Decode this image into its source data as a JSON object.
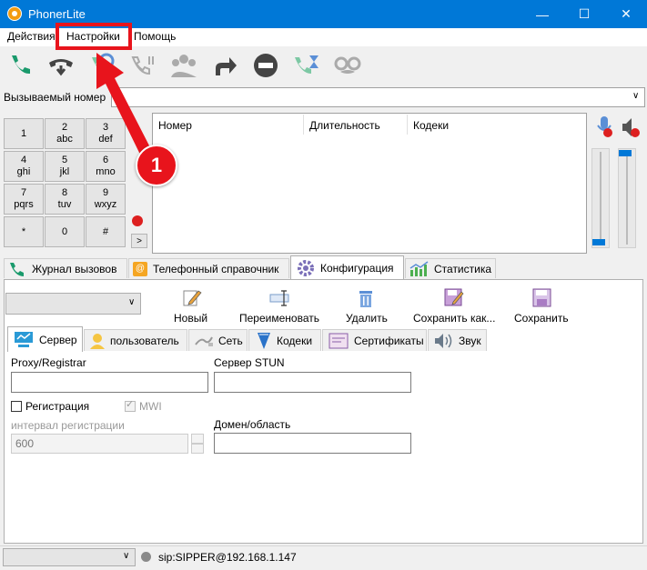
{
  "window": {
    "title": "PhonerLite",
    "minimize": "—",
    "maximize": "☐",
    "close": "✕"
  },
  "menu": {
    "items": [
      "Действия",
      "Настройки",
      "Помощь"
    ]
  },
  "toolbar": {
    "icons": [
      "phone-call-icon",
      "hold-icon",
      "transfer-icon",
      "pause-call-icon",
      "conference-icon",
      "forward-icon",
      "dnd-icon",
      "wait-call-icon",
      "incognito-icon"
    ]
  },
  "callee": {
    "label": "Вызываемый номер"
  },
  "dialpad": {
    "keys": [
      {
        "d": "1",
        "s": ""
      },
      {
        "d": "2",
        "s": "abc"
      },
      {
        "d": "3",
        "s": "def"
      },
      {
        "d": "4",
        "s": "ghi"
      },
      {
        "d": "5",
        "s": "jkl"
      },
      {
        "d": "6",
        "s": "mno"
      },
      {
        "d": "7",
        "s": "pqrs"
      },
      {
        "d": "8",
        "s": "tuv"
      },
      {
        "d": "9",
        "s": "wxyz"
      },
      {
        "d": "*",
        "s": ""
      },
      {
        "d": "0",
        "s": ""
      },
      {
        "d": "#",
        "s": ""
      }
    ],
    "expand": ">"
  },
  "calls": {
    "columns": [
      "Номер",
      "Длительность",
      "Кодеки"
    ]
  },
  "annotation": {
    "number": "1",
    "color": "#e8141c"
  },
  "tabs": [
    {
      "label": "Журнал вызовов",
      "icon": "call-log-icon"
    },
    {
      "label": "Телефонный справочник",
      "icon": "phonebook-icon"
    },
    {
      "label": "Конфигурация",
      "icon": "gear-icon"
    },
    {
      "label": "Статистика",
      "icon": "statistics-icon"
    }
  ],
  "config": {
    "actions": [
      "Новый",
      "Переименовать",
      "Удалить",
      "Сохранить как...",
      "Сохранить"
    ],
    "subtabs": [
      "Сервер",
      "пользователь",
      "Сеть",
      "Кодеки",
      "Сертификаты",
      "Звук"
    ],
    "proxy_label": "Proxy/Registrar",
    "stun_label": "Сервер STUN",
    "register_label": "Регистрация",
    "mwi_label": "MWI",
    "interval_label": "интервал регистрации",
    "interval_value": "600",
    "domain_label": "Домен/область"
  },
  "status": {
    "text": "sip:SIPPER@192.168.1.147"
  },
  "colors": {
    "accent": "#0078d7",
    "highlight": "#e8141c",
    "green": "#1a9a6c",
    "gray": "#9a9a9a"
  }
}
